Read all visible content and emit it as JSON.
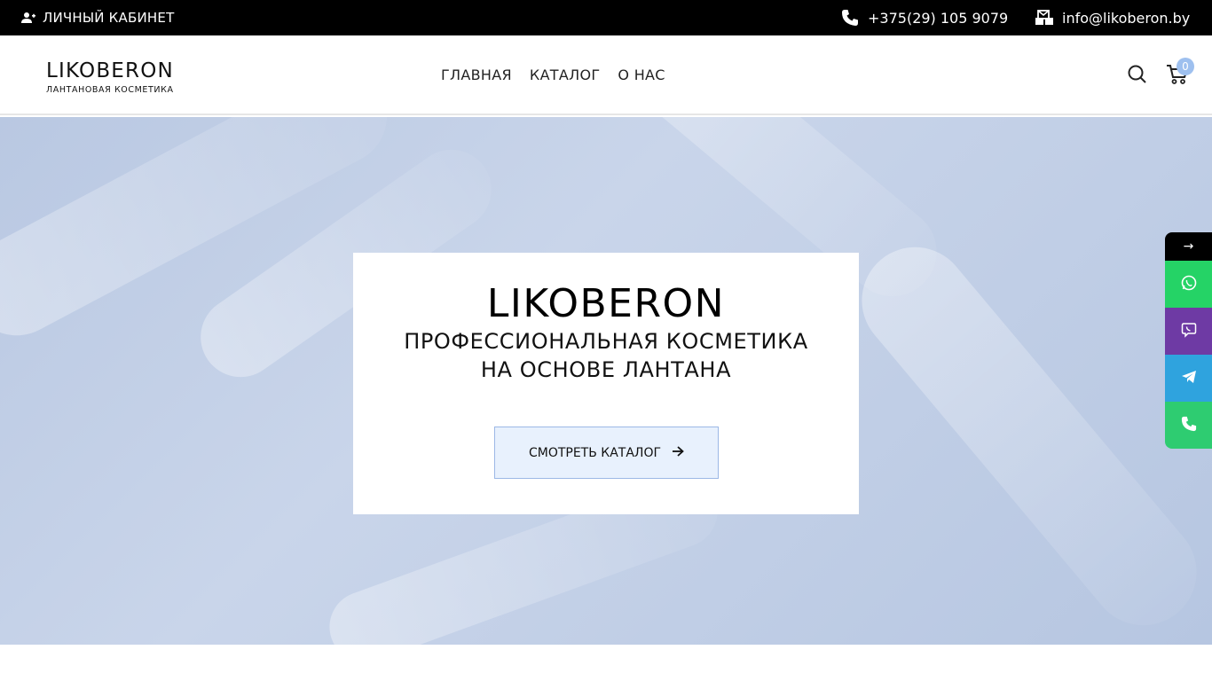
{
  "topbar": {
    "account_label": "ЛИЧНЫЙ КАБИНЕТ",
    "phone": "+375(29) 105 9079",
    "email": "info@likoberon.by"
  },
  "header": {
    "logo_word": "LIKOBERON",
    "logo_sub": "ЛАНТАНОВАЯ КОСМЕТИКА",
    "nav": [
      "ГЛАВНАЯ",
      "КАТАЛОГ",
      "О НАС"
    ],
    "cart_count": "0"
  },
  "hero": {
    "title": "LIKOBERON",
    "subtitle_line1": "ПРОФЕССИОНАЛЬНАЯ КОСМЕТИКА",
    "subtitle_line2": "НА ОСНОВЕ ЛАНТАНА",
    "button_label": "СМОТРЕТЬ КАТАЛОГ"
  },
  "side_bar": {
    "toggle": "→",
    "icons": [
      "whatsapp-icon",
      "viber-icon",
      "telegram-icon",
      "phone-icon"
    ]
  },
  "colors": {
    "topbar_bg": "#000000",
    "hero_bg": "#c4d1e7",
    "button_bg": "#e8f1fd",
    "badge": "#9ec0ef",
    "whatsapp": "#25d366",
    "viber": "#6e3aa4",
    "telegram": "#2fa3de",
    "phone": "#2ecc71"
  }
}
